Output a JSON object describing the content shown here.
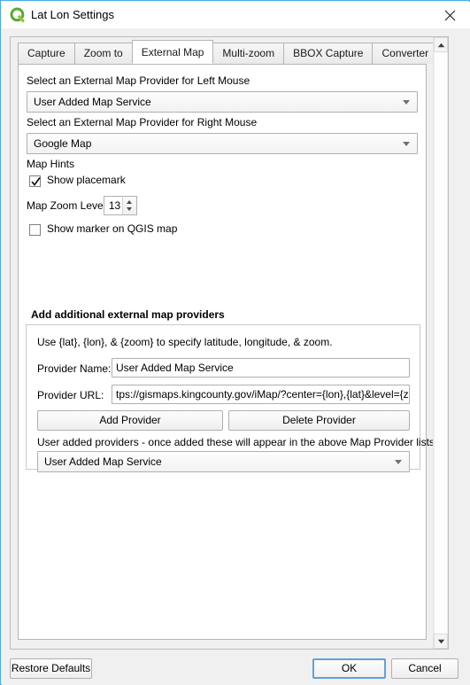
{
  "window": {
    "title": "Lat Lon Settings",
    "app_icon": "qgis-icon",
    "close_icon": "close-icon",
    "accent_color": "#4cacdf"
  },
  "tabs": [
    {
      "label": "Capture",
      "active": false
    },
    {
      "label": "Zoom to",
      "active": false
    },
    {
      "label": "External Map",
      "active": true
    },
    {
      "label": "Multi-zoom",
      "active": false
    },
    {
      "label": "BBOX Capture",
      "active": false
    },
    {
      "label": "Converter",
      "active": false
    }
  ],
  "external_map": {
    "left_mouse_label": "Select an External Map Provider for Left Mouse",
    "left_mouse_value": "User Added Map Service",
    "right_mouse_label": "Select an External Map Provider for Right Mouse",
    "right_mouse_value": "Google Map",
    "map_hints_label": "Map Hints",
    "show_placemark_label": "Show placemark",
    "show_placemark_checked": true,
    "map_zoom_level_label": "Map Zoom Level:",
    "map_zoom_level_value": "13",
    "show_marker_label": "Show marker on QGIS map",
    "show_marker_checked": false
  },
  "add_providers": {
    "group_title": "Add additional external map providers",
    "hint": "Use {lat},  {lon}, & {zoom} to specify latitude, longitude, & zoom.",
    "provider_name_label": "Provider Name:",
    "provider_name_value": "User Added Map Service",
    "provider_url_label": "Provider URL:",
    "provider_url_value": "tps://gismaps.kingcounty.gov/iMap/?center={lon},{lat}&level={zoom}",
    "add_provider_button": "Add Provider",
    "delete_provider_button": "Delete Provider",
    "user_added_note": "User added providers - once added these will appear in the above Map Provider lists.",
    "user_added_value": "User Added Map Service"
  },
  "footer": {
    "restore_defaults": "Restore Defaults",
    "ok": "OK",
    "cancel": "Cancel"
  },
  "scrollbar": {
    "up_icon": "scroll-up-arrow-icon",
    "down_icon": "scroll-down-arrow-icon"
  }
}
